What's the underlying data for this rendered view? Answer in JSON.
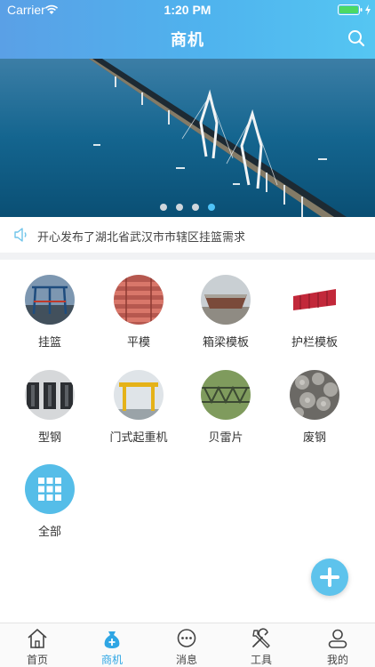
{
  "status_bar": {
    "carrier": "Carrier",
    "time": "1:20 PM"
  },
  "header": {
    "title": "商机",
    "accent_color": "#4fb3ee"
  },
  "banner": {
    "dots": 4,
    "active_dot": 4
  },
  "notice": {
    "text": "开心发布了湖北省武汉市市辖区挂篮需求"
  },
  "categories": [
    {
      "label": "挂篮",
      "icon": "hanging-basket-photo"
    },
    {
      "label": "平模",
      "icon": "flat-formwork-photo"
    },
    {
      "label": "箱梁模板",
      "icon": "box-girder-formwork-photo"
    },
    {
      "label": "护栏模板",
      "icon": "guardrail-formwork-photo"
    },
    {
      "label": "型钢",
      "icon": "section-steel-photo"
    },
    {
      "label": "门式起重机",
      "icon": "gantry-crane-photo"
    },
    {
      "label": "贝雷片",
      "icon": "bailey-panel-photo"
    },
    {
      "label": "废钢",
      "icon": "scrap-steel-photo"
    },
    {
      "label": "全部",
      "icon": "grid-icon"
    }
  ],
  "tabbar": {
    "active_color": "#2fa6e4",
    "items": [
      {
        "label": "首页",
        "icon": "home-icon"
      },
      {
        "label": "商机",
        "icon": "money-bag-icon"
      },
      {
        "label": "消息",
        "icon": "message-icon"
      },
      {
        "label": "工具",
        "icon": "tools-icon"
      },
      {
        "label": "我的",
        "icon": "user-icon"
      }
    ]
  }
}
